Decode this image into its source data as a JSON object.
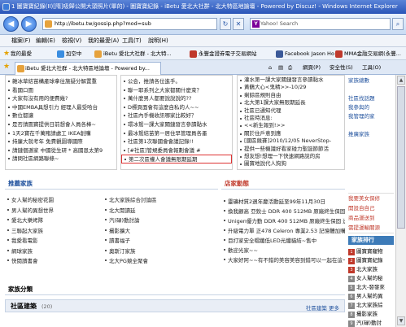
{
  "window": {
    "title": "1 圖寶寶紀錄(II)[隋]吸歸公開大頭照片(單的) - 圖寶寶紀錄 - iBetu 愛北大社群 - 北大特區地論壇 - Powered by Discuz! - Windows Internet Explorer"
  },
  "browser": {
    "address": "http://ibetu.tw/gossip.php?mod=sub",
    "search_placeholder": "Yahoo! Search",
    "menu": [
      "檔案(F)",
      "編輯(E)",
      "檢視(V)",
      "我的最愛(A)",
      "工具(T)",
      "說明(H)"
    ],
    "favorites_label": "我的最愛",
    "favorites": [
      "加空中",
      "iBetu 愛北大社群 - 北大特...",
      "永豐金證券電子交易網站",
      "Facebook Jason Ho",
      "MMA金融交易網(永豐..."
    ],
    "tab_title": "iBetu 愛北大社群 - 北大特區地論壇 - Powered by...",
    "commands": [
      "網頁(P)",
      "安全性(S)",
      "工具(O)"
    ]
  },
  "content": {
    "left_list_top": [
      "雜冰草結苗構產球拿往施疑分解置重",
      "看國口圍",
      "大家有沒有用的便費幾?",
      "中國EMBA具想引力  經理人最受哈台",
      "數位都讓",
      "是否請圍寶提供日前想會人員各棒~",
      "1天2寶在千萬賭請處工 IKEA創購",
      "持廉大就考年 免費觀園導國際",
      "請鏈個遜家 中國從生研 * 高國恩太第9",
      "請問社區網路聯條~"
    ],
    "mid_list_top": [
      "公会，推請各位進手。",
      "聯一耶系列之大家都關什麼束？",
      "萬什麼男人都要說說說的??",
      "D標頁面會有這麼自私的人~~",
      "社區內手機收訊哪家比較好？",
      "環冰鴛一課大家關鏈發言參讀黏水",
      "最冰鴛結苗第一居住早管理員各墨",
      "社區第1次聯國會會議記錄!!",
      "[#社區]管規委員會報劃會議 #",
      "第二次區權人會議無限期延期"
    ],
    "right_list_top": [
      "灌水第一課大家關鏈發言參讀黏水",
      "黃鶴大心<鬼精>>-10/29",
      "剩餘區規則自由",
      "北大第1課大家無限期延長",
      "社區已通知代理",
      "社區時消息:",
      "<<新生報到!>>",
      "關於住戶意到應",
      "[國區競賽]2010/12/05 NeverStop-",
      "提供一些機識好看家碰力聖誕節節活",
      "想友想!想理一下快速網路說的房",
      "圖寶地說代人狗狗"
    ],
    "right_sidebar_top": [
      "家族總數",
      "",
      "社區找話題",
      "我參與的",
      "我管理的家",
      "",
      "推廣家族"
    ],
    "side_promo": [
      "我要美女保修",
      "開設自自己",
      "商品運送到",
      "需提運輸關源"
    ],
    "section_family": "推薦家族",
    "family_list_a": [
      "女人幫的秘密花園",
      "男人幫的異想世界",
      "愛北大樂烤隊",
      "三聯起大家族",
      "我愛看電影",
      "網球家族",
      "快閱讀書會"
    ],
    "family_list_b": [
      "北大家族綜合討論區",
      "北大閱讀延",
      "汽(碌)動討論",
      "攝影擴大",
      "讀書福子",
      "奧斯汀家族",
      "北大PG競全聚會"
    ],
    "section_shop": "店家動態",
    "shop_list": [
      "靈礦材質2週年慶活動延至99年11月30日",
      "換我顧高 亞銳士 DDR 400 512MB 原廠終生保固 送運費 C",
      "Unigen優力勤 DDR 400 512MB 原廠終生保固 送運費 C 蟲勵",
      "升級電力單 正478 Celeron 專業2.53 記憶體加購區 送高偏3G顯",
      "目打家安全帽纖低LED光纖貓結~售中",
      "歡迎光家~~",
      "大家好阿~~有不錯的美容美容到錯可以一起在這一起分享喔!"
    ],
    "family_rank_head": "家族排行",
    "family_rank": [
      "圖寶寶寵物",
      "圖寶寶紀錄",
      "北大家族",
      "女人幫的秘",
      "北大-發發來",
      "男人幫的異",
      "北大家族綜",
      "攝影家族",
      "汽(碌)動討"
    ],
    "section_class": "家族分類",
    "section_community": "社區建築",
    "community_count": "(20)",
    "community_more": "社區建築 更多"
  }
}
